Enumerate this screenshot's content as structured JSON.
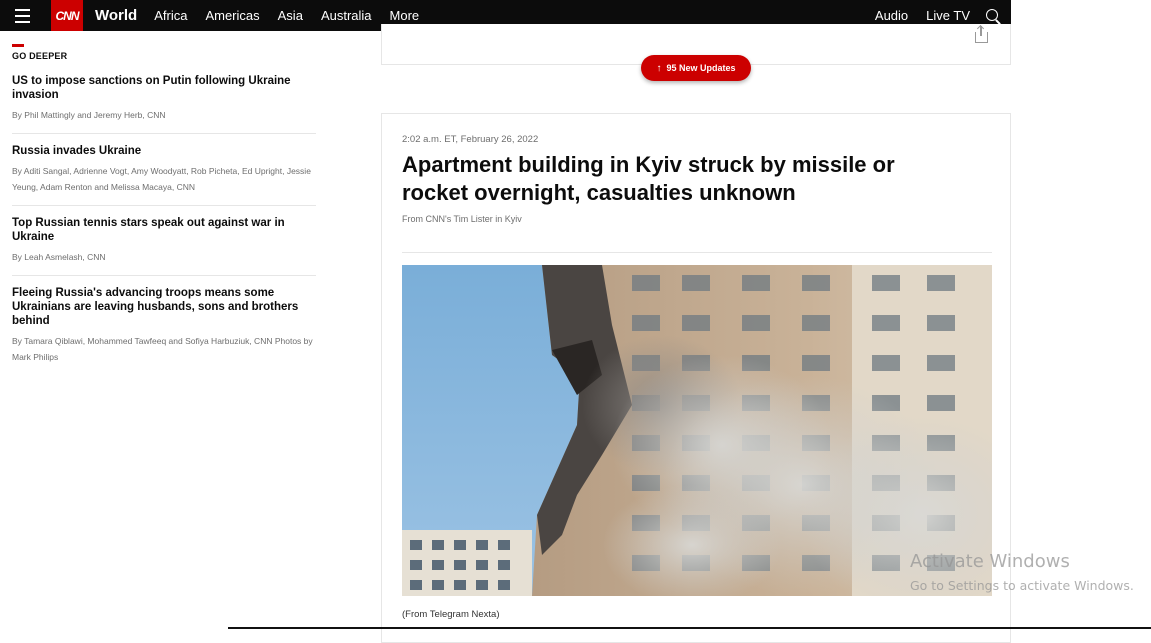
{
  "nav": {
    "logo": "CNN",
    "section": "World",
    "links": [
      "Africa",
      "Americas",
      "Asia",
      "Australia",
      "More"
    ],
    "right": [
      "Audio",
      "Live TV"
    ]
  },
  "sidebar": {
    "heading": "GO DEEPER",
    "stories": [
      {
        "title": "US to impose sanctions on Putin following Ukraine invasion",
        "byline": "By Phil Mattingly and Jeremy Herb, CNN"
      },
      {
        "title": "Russia invades Ukraine",
        "byline": "By Aditi Sangal, Adrienne Vogt, Amy Woodyatt, Rob Picheta, Ed Upright, Jessie Yeung, Adam Renton and Melissa Macaya, CNN"
      },
      {
        "title": "Top Russian tennis stars speak out against war in Ukraine",
        "byline": "By Leah Asmelash, CNN"
      },
      {
        "title": "Fleeing Russia's advancing troops means some Ukrainians are leaving husbands, sons and brothers behind",
        "byline": "By Tamara Qiblawi, Mohammed Tawfeeq and Sofiya Harbuziuk, CNN Photos by Mark Philips"
      }
    ]
  },
  "updates_pill": "95 New Updates",
  "post": {
    "time": "2:02 a.m. ET, February 26, 2022",
    "headline": "Apartment building in Kyiv struck by missile or rocket overnight, casualties unknown",
    "author": "From CNN's Tim Lister in Kyiv",
    "caption": "(From Telegram Nexta)"
  },
  "watermark": {
    "title": "Activate Windows",
    "subtitle": "Go to Settings to activate Windows."
  },
  "colors": {
    "brand_red": "#cc0000",
    "nav_bg": "#0c0c0c"
  }
}
